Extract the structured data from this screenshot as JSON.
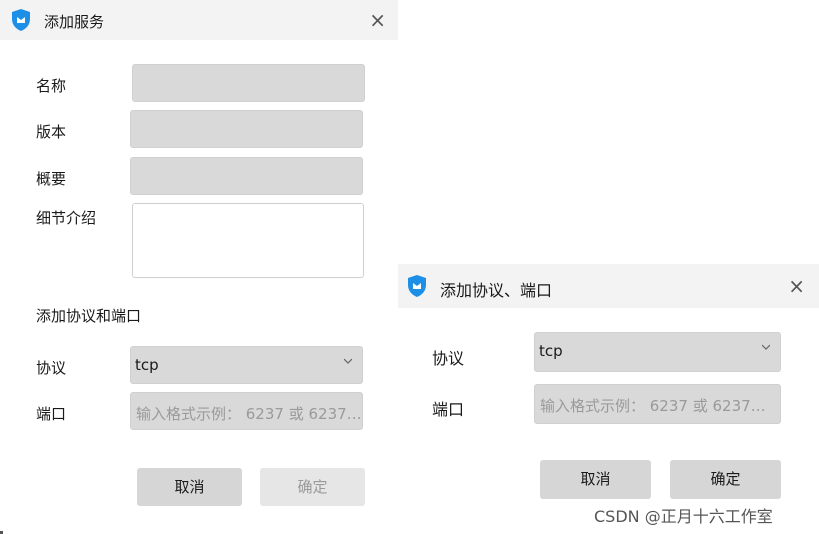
{
  "add_service_dialog": {
    "title": "添加服务",
    "close_glyph": "×",
    "fields": {
      "name_label": "名称",
      "version_label": "版本",
      "summary_label": "概要",
      "details_label": "细节介绍"
    },
    "section_heading": "添加协议和端口",
    "protocol_label": "协议",
    "protocol_value": "tcp",
    "port_label": "端口",
    "port_placeholder": "输入格式示例： 6237 或 6237…",
    "cancel_label": "取消",
    "confirm_label": "确定"
  },
  "add_protocol_dialog": {
    "title": "添加协议、端口",
    "close_glyph": "×",
    "protocol_label": "协议",
    "protocol_value": "tcp",
    "port_label": "端口",
    "port_placeholder": "输入格式示例： 6237 或 6237…",
    "cancel_label": "取消",
    "confirm_label": "确定"
  },
  "watermark": "CSDN @正月十六工作室",
  "colors": {
    "shield_blue": "#1e8fe6",
    "field_gray": "#d9d9d9",
    "button_gray": "#d6d6d6",
    "titlebar": "#f3f3f3"
  },
  "icons": {
    "app": "shield-icon",
    "close": "close-icon",
    "dropdown": "chevron-down-icon"
  }
}
